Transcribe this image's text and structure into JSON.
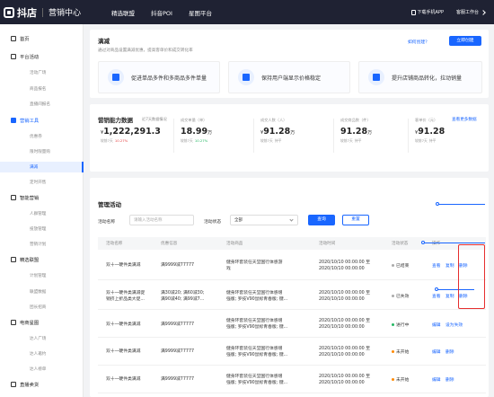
{
  "topbar": {
    "logo": "抖店",
    "sub": "营销中心",
    "nav": [
      "精选联盟",
      "抖音POI",
      "星图平台"
    ],
    "download": "下载手机APP",
    "workspace": "客服工作台"
  },
  "sidebar": {
    "items": [
      {
        "label": "首页",
        "level": 1
      },
      {
        "label": "平台活动",
        "level": 1
      },
      {
        "label": "活动广场",
        "level": 2
      },
      {
        "label": "商品报名",
        "level": 2
      },
      {
        "label": "直播间报名",
        "level": 2
      },
      {
        "label": "营销工具",
        "level": 1,
        "blue": true
      },
      {
        "label": "优惠券",
        "level": 2
      },
      {
        "label": "限时限量购",
        "level": 2
      },
      {
        "label": "满减",
        "level": 2,
        "active": true
      },
      {
        "label": "定时开售",
        "level": 2
      },
      {
        "label": "智能营销",
        "level": 1
      },
      {
        "label": "人群管理",
        "level": 2
      },
      {
        "label": "投放管理",
        "level": 2
      },
      {
        "label": "营销计划",
        "level": 2
      },
      {
        "label": "精选联盟",
        "level": 1
      },
      {
        "label": "计划管理",
        "level": 2
      },
      {
        "label": "联盟数据",
        "level": 2
      },
      {
        "label": "团长招商",
        "level": 2
      },
      {
        "label": "电商星图",
        "level": 1
      },
      {
        "label": "达人广场",
        "level": 2
      },
      {
        "label": "达人邀约",
        "level": 2
      },
      {
        "label": "达人榜单",
        "level": 2
      },
      {
        "label": "直播卖货",
        "level": 1
      }
    ]
  },
  "intro": {
    "title": "满减",
    "desc": "通过对商品设置满减优惠，提高客单价和成交转化率",
    "help": "如何创建？",
    "create": "立即创建",
    "features": [
      "促进单品多件和多商品多件单量",
      "保持用户端显示价格稳定",
      "提升店铺商品转化，拉动销量"
    ]
  },
  "stats": {
    "title": "营销能力数据",
    "period": "近7天数据情况",
    "more": "查看更多数据",
    "metrics": [
      {
        "label": "成交金额（元）",
        "value": "1,222,291.3",
        "prefix": "¥",
        "sub": "较前7天",
        "change": "10.27%",
        "dir": "up"
      },
      {
        "label": "成交单量（单）",
        "value": "18.99",
        "unit": "万",
        "sub": "较前7天",
        "change": "10.27%",
        "dir": "down"
      },
      {
        "label": "成交人数（人）",
        "value": "91.28",
        "prefix": "¥",
        "unit": "万",
        "sub": "较前7天",
        "change": "持平",
        "dir": "flat"
      },
      {
        "label": "成交商品数（件）",
        "value": "91.28",
        "unit": "万",
        "sub": "较前7天",
        "change": "持平",
        "dir": "flat"
      },
      {
        "label": "客单价（元）",
        "value": "91.28",
        "prefix": "¥",
        "sub": "较前7天",
        "change": "持平",
        "dir": "flat"
      }
    ]
  },
  "manage": {
    "title": "管理活动",
    "name_label": "活动名称",
    "name_placeholder": "请输入活动名称",
    "status_label": "活动状态",
    "status_value": "全部",
    "query": "查询",
    "reset": "重置",
    "columns": [
      "活动名称",
      "优惠信息",
      "活动商品",
      "活动时间",
      "活动状态",
      "操作"
    ],
    "rows": [
      {
        "name": [
          "双十一硬件类满减"
        ],
        "promo": [
          "满9999减77777"
        ],
        "goods": [
          "健身环套装任天堂国行体感游",
          "戏"
        ],
        "time": [
          "2020/10/10 00:00:00 至",
          "2020/10/10 00:00:00"
        ],
        "status": "已结束",
        "status_color": "#aaaaaa",
        "actions": [
          "查看",
          "复制",
          "删除"
        ]
      },
      {
        "name": [
          "双十一硬件类满减促",
          "销挤上折品类大促..."
        ],
        "promo": [
          "满30减20; 满60减30;",
          "满90减40; 满99减7..."
        ],
        "goods": [
          "健身环套装任天堂国行体感增",
          "强版; 罗技V90鼠标青春版; 键..."
        ],
        "time": [
          "2020/10/10 00:00:00 至",
          "2020/10/10 00:00:00"
        ],
        "status": "已失效",
        "status_color": "#aaaaaa",
        "actions": [
          "查看",
          "复制",
          "删除"
        ]
      },
      {
        "name": [
          "双十一硬件类满减"
        ],
        "promo": [
          "满9999减77777"
        ],
        "goods": [
          "健身环套装任天堂国行体感增",
          "强版; 罗技V90鼠标青春版; 键..."
        ],
        "time": [
          "2020/10/10 00:00:00 至",
          "2020/10/10 00:00:00"
        ],
        "status": "进行中",
        "status_color": "#25b864",
        "actions": [
          "编辑",
          "设为失效"
        ]
      },
      {
        "name": [
          "双十一硬件类满减"
        ],
        "promo": [
          "满9999减77777"
        ],
        "goods": [
          "健身环套装任天堂国行体感增",
          "强版; 罗技V90鼠标青春版; 键..."
        ],
        "time": [
          "2020/10/10 00:00:00 至",
          "2020/10/10 00:00:00"
        ],
        "status": "未开始",
        "status_color": "#ff8a00",
        "actions": [
          "编辑",
          "删除"
        ]
      },
      {
        "name": [
          "双十一硬件类满减"
        ],
        "promo": [
          "满9999减77777"
        ],
        "goods": [
          "健身环套装任天堂国行体感增",
          "强版; 罗技V90鼠标青春版; 键..."
        ],
        "time": [
          "2020/10/10 00:00:00 至",
          "2020/10/10 00:00:00"
        ],
        "status": "未开始",
        "status_color": "#ff8a00",
        "actions": [
          "编辑",
          "删除"
        ]
      }
    ]
  }
}
